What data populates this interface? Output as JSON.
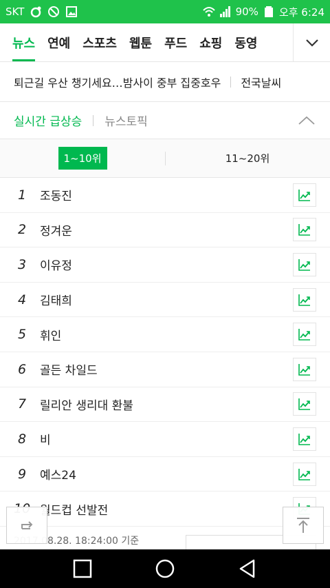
{
  "status": {
    "carrier": "SKT",
    "battery": "90%",
    "time": "오후 6:24"
  },
  "tabs": {
    "items": [
      {
        "label": "뉴스",
        "active": true
      },
      {
        "label": "연예"
      },
      {
        "label": "스포츠"
      },
      {
        "label": "웹툰"
      },
      {
        "label": "푸드"
      },
      {
        "label": "쇼핑"
      },
      {
        "label": "동영"
      }
    ],
    "toggle_icon": "chevron-down-icon"
  },
  "headline": {
    "text": "퇴근길 우산 챙기세요…밤사이 중부 집중호우",
    "weather": "전국날씨"
  },
  "section": {
    "active": "실시간 급상승",
    "inactive": "뉴스토픽"
  },
  "range": {
    "first": "1~10위",
    "second": "11~20위"
  },
  "ranking": [
    {
      "rank": "1",
      "keyword": "조동진"
    },
    {
      "rank": "2",
      "keyword": "정겨운"
    },
    {
      "rank": "3",
      "keyword": "이유정"
    },
    {
      "rank": "4",
      "keyword": "김태희"
    },
    {
      "rank": "5",
      "keyword": "휘인"
    },
    {
      "rank": "6",
      "keyword": "골든 차일드"
    },
    {
      "rank": "7",
      "keyword": "릴리안 생리대 환불"
    },
    {
      "rank": "8",
      "keyword": "비"
    },
    {
      "rank": "9",
      "keyword": "예스24"
    },
    {
      "rank": "10",
      "keyword": "월드컵 선발전"
    }
  ],
  "footer": {
    "timestamp": "2017.08.28. 18:24:00 기준"
  },
  "colors": {
    "accent": "#00b84f",
    "statusbar": "#1fc24b"
  }
}
